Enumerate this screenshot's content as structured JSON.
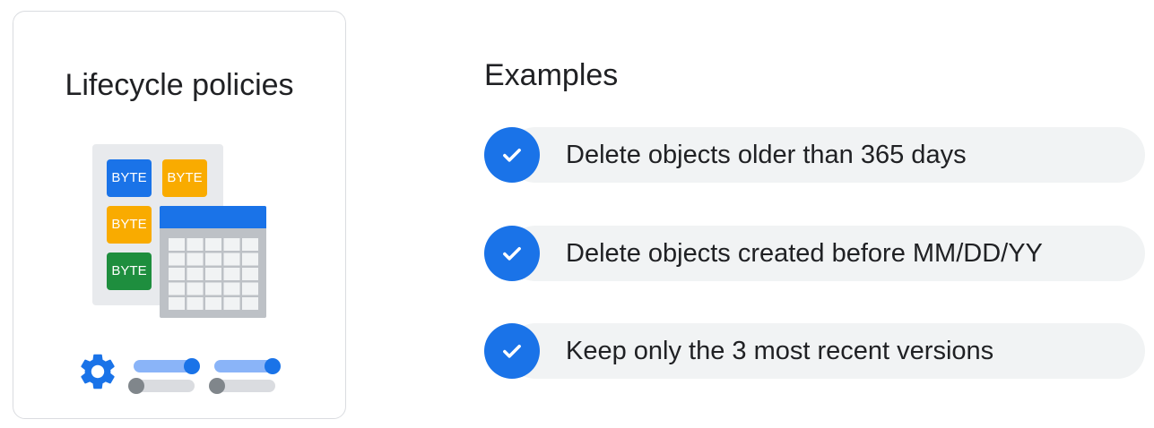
{
  "card": {
    "title": "Lifecycle policies",
    "illustration": {
      "byte_labels": [
        "BYTE",
        "BYTE",
        "BYTE",
        "BYTE"
      ]
    },
    "icons": [
      "gear-icon",
      "toggle-slider-icon",
      "toggle-slider-icon"
    ]
  },
  "examples": {
    "title": "Examples",
    "items": [
      {
        "text": "Delete objects older than 365 days",
        "icon": "check-icon"
      },
      {
        "text": "Delete objects created before MM/DD/YY",
        "icon": "check-icon"
      },
      {
        "text": "Keep only the 3 most recent versions",
        "icon": "check-icon"
      }
    ]
  },
  "colors": {
    "blue": "#1a73e8",
    "light_blue": "#8ab4f8",
    "yellow": "#f9ab00",
    "green": "#1e8e3e",
    "pill_bg": "#f1f3f4",
    "card_border": "#dadce0",
    "text": "#202124"
  }
}
